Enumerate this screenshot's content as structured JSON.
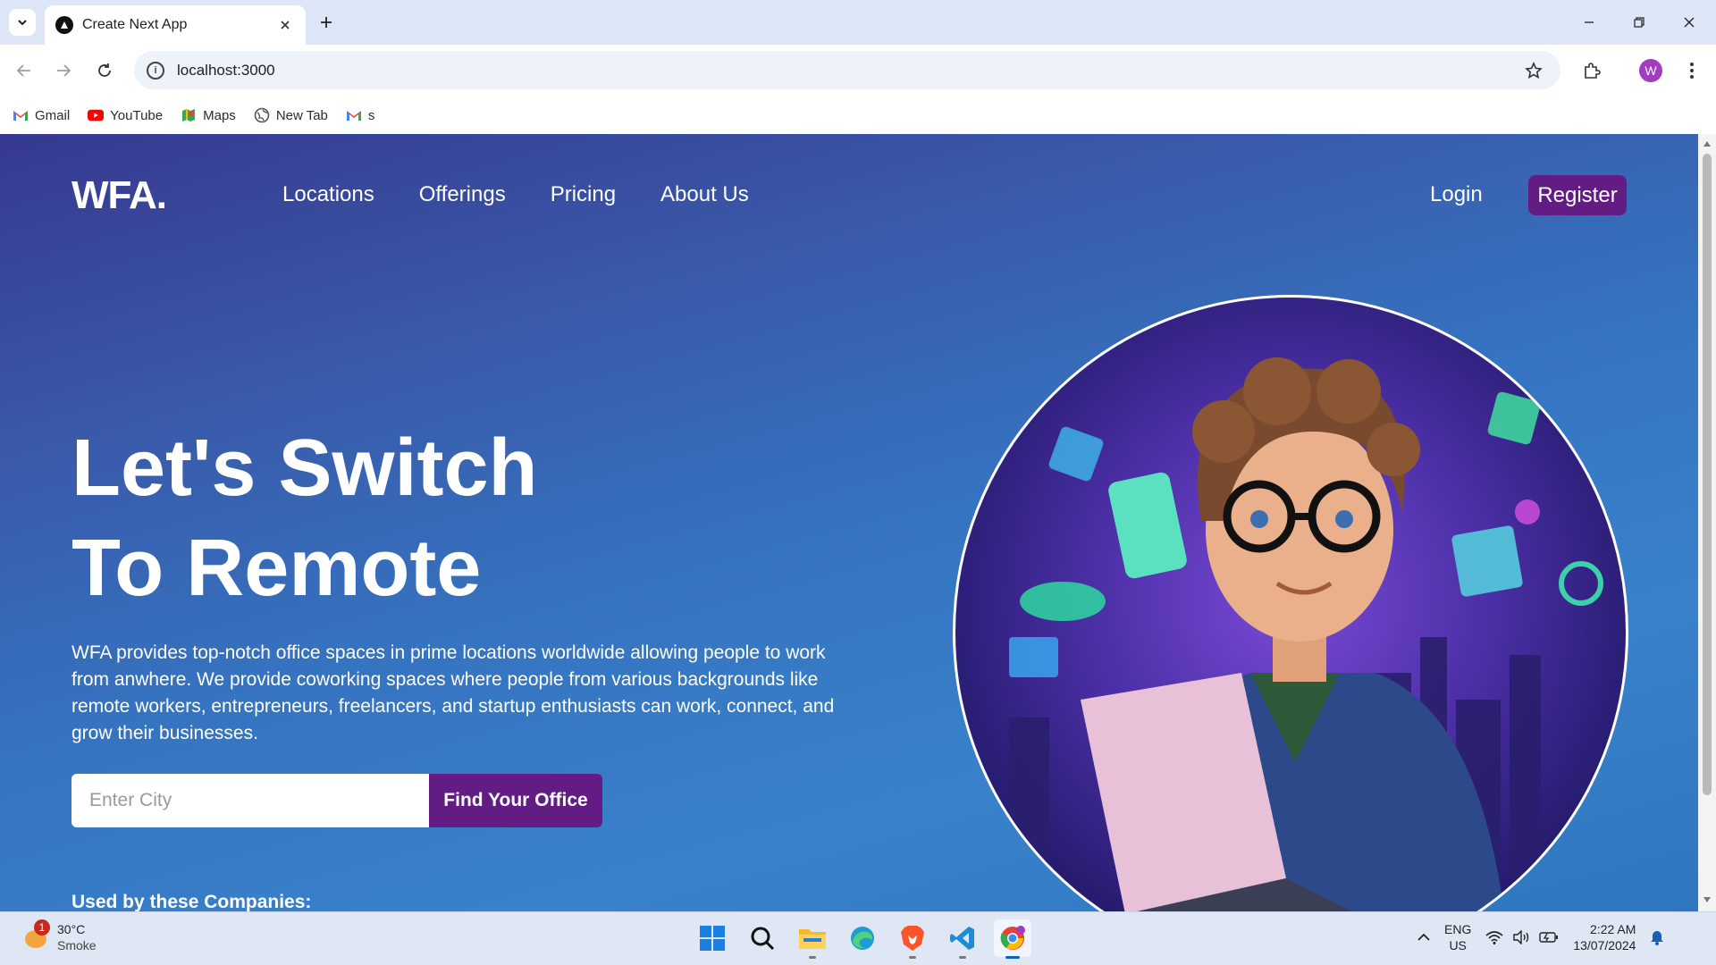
{
  "browser": {
    "tab_title": "Create Next App",
    "url": "localhost:3000",
    "profile_initial": "W",
    "bookmarks": [
      {
        "label": "Gmail",
        "icon": "gmail-icon"
      },
      {
        "label": "YouTube",
        "icon": "youtube-icon"
      },
      {
        "label": "Maps",
        "icon": "maps-icon"
      },
      {
        "label": "New Tab",
        "icon": "globe-icon"
      },
      {
        "label": "s",
        "icon": "gmail-icon"
      }
    ]
  },
  "site": {
    "logo": "WFA.",
    "nav": [
      "Locations",
      "Offerings",
      "Pricing",
      "About Us"
    ],
    "login_label": "Login",
    "register_label": "Register",
    "hero_title_line1": "Let's Switch",
    "hero_title_line2": "To Remote",
    "hero_description": "WFA provides top-notch office spaces in prime locations worldwide allowing people to work from anwhere. We provide coworking spaces where people from various backgrounds like remote workers, entrepreneurs, freelancers, and startup enthusiasts can work, connect, and grow their businesses.",
    "search_placeholder": "Enter City",
    "search_button": "Find Your Office",
    "companies_heading": "Used by these Companies:",
    "accent_color": "#631c84"
  },
  "taskbar": {
    "weather_temp": "30°C",
    "weather_desc": "Smoke",
    "weather_badge": "1",
    "lang_line1": "ENG",
    "lang_line2": "US",
    "time": "2:22 AM",
    "date": "13/07/2024",
    "apps": [
      "windows-start-icon",
      "search-icon",
      "file-explorer-icon",
      "edge-icon",
      "brave-icon",
      "vscode-icon",
      "chrome-icon"
    ]
  }
}
